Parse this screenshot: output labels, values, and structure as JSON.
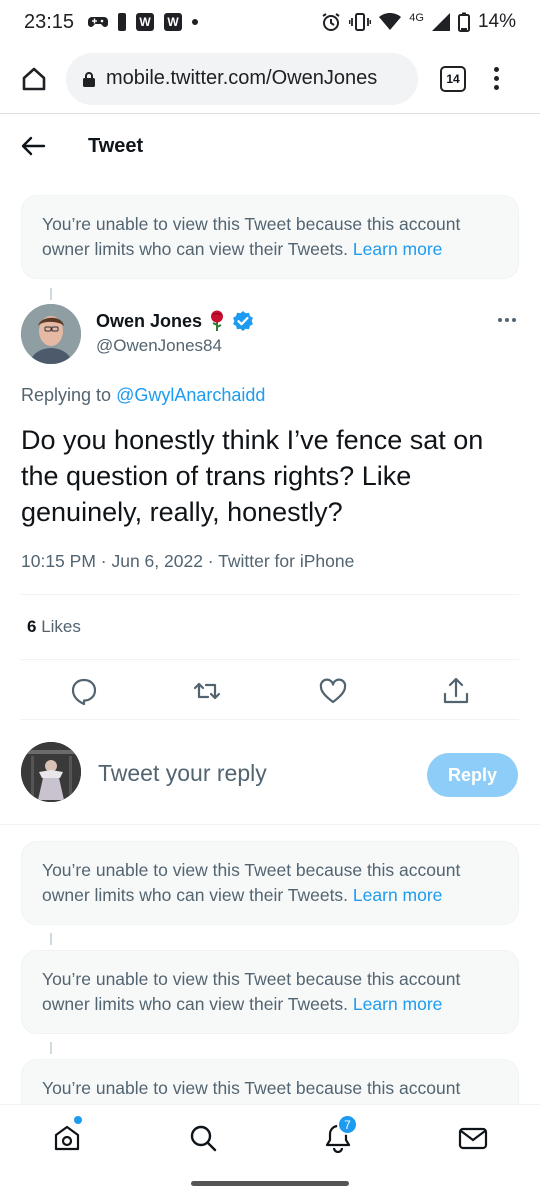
{
  "status_bar": {
    "time": "23:15",
    "network": "4G",
    "battery": "14%",
    "icons": [
      "gamepad-icon",
      "alert-icon",
      "w-app-icon",
      "w-app-icon",
      "dot-icon",
      "alarm-icon",
      "vibrate-icon",
      "wifi-icon",
      "signal-icon",
      "battery-icon"
    ]
  },
  "browser": {
    "url": "mobile.twitter.com/OwenJones",
    "tab_count": "14"
  },
  "header": {
    "title": "Tweet"
  },
  "notice": {
    "text": "You’re unable to view this Tweet because this account owner limits who can view their Tweets. ",
    "learn_more": "Learn more"
  },
  "tweet": {
    "author_name": "Owen Jones",
    "author_handle": "@OwenJones84",
    "replying_prefix": "Replying to ",
    "replying_to": "@GwylAnarchaidd",
    "text": "Do you honestly think I’ve fence sat on the question of trans rights? Like genuinely, really, honestly?",
    "meta": "10:15 PM · Jun 6, 2022 · Twitter for iPhone",
    "likes_count": "6",
    "likes_label": "Likes"
  },
  "reply": {
    "placeholder": "Tweet your reply",
    "button": "Reply"
  },
  "bottom_nav": {
    "notification_badge": "7"
  },
  "colors": {
    "accent": "#1d9bf0",
    "reply_button": "#8ecdf8",
    "muted_text": "#536471",
    "rose": "#c8102e"
  }
}
